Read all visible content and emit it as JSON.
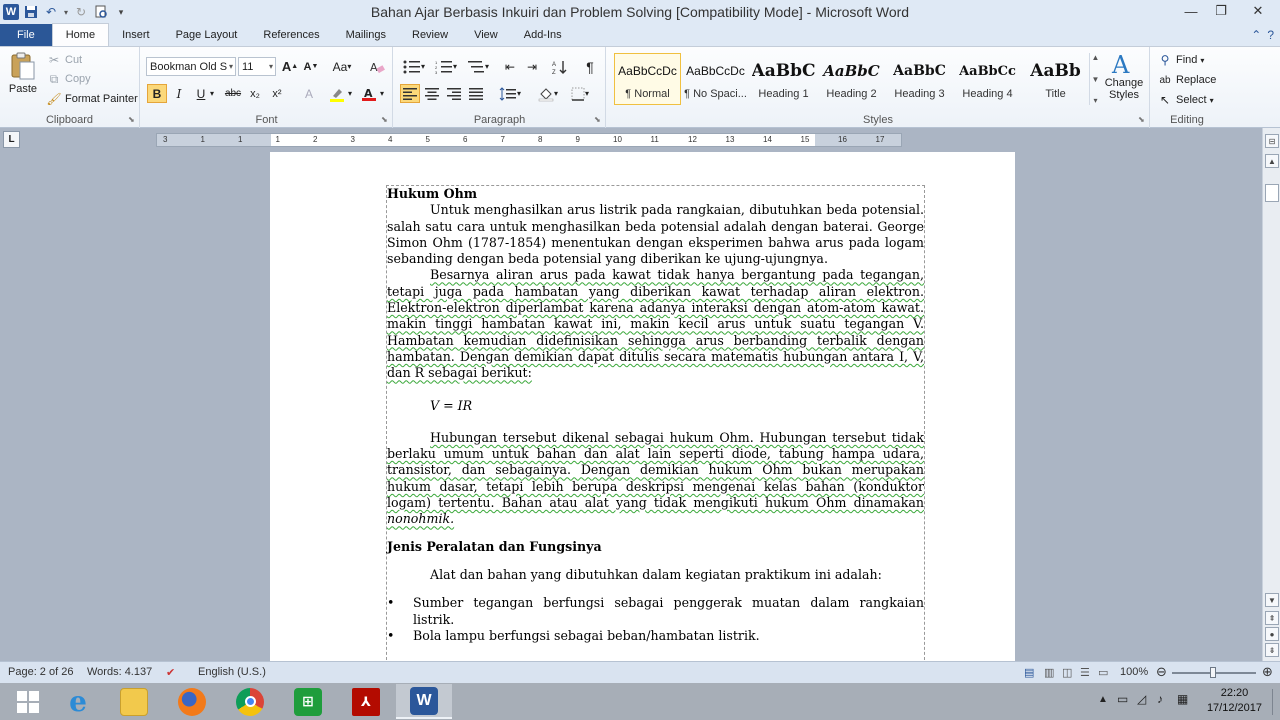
{
  "window": {
    "title": "Bahan Ajar Berbasis Inkuiri dan Problem Solving [Compatibility Mode]  -  Microsoft Word"
  },
  "tabs": [
    "File",
    "Home",
    "Insert",
    "Page Layout",
    "References",
    "Mailings",
    "Review",
    "View",
    "Add-Ins"
  ],
  "active_tab": "Home",
  "clipboard": {
    "paste": "Paste",
    "cut": "Cut",
    "copy": "Copy",
    "format_painter": "Format Painter",
    "label": "Clipboard"
  },
  "font": {
    "name": "Bookman Old S",
    "size": "11",
    "label": "Font",
    "bold": "B",
    "italic": "I",
    "underline": "U",
    "strike": "abc",
    "sub": "x₂",
    "sup": "x²",
    "case": "Aa"
  },
  "paragraph": {
    "label": "Paragraph",
    "pilcrow": "¶"
  },
  "styles": {
    "label": "Styles",
    "items": [
      {
        "sample": "AaBbCcDc",
        "name": "¶ Normal"
      },
      {
        "sample": "AaBbCcDc",
        "name": "¶ No Spaci..."
      },
      {
        "sample": "AaBbC",
        "name": "Heading 1"
      },
      {
        "sample": "AaBbC",
        "name": "Heading 2"
      },
      {
        "sample": "AaBbC",
        "name": "Heading 3"
      },
      {
        "sample": "AaBbCc",
        "name": "Heading 4"
      },
      {
        "sample": "AaBb",
        "name": "Title"
      }
    ],
    "change_styles_1": "Change",
    "change_styles_2": "Styles"
  },
  "editing": {
    "find": "Find",
    "replace": "Replace",
    "select": "Select",
    "label": "Editing"
  },
  "ruler": {
    "ticks": [
      "3",
      "1",
      "1",
      "1",
      "2",
      "3",
      "4",
      "5",
      "6",
      "7",
      "8",
      "9",
      "10",
      "11",
      "12",
      "13",
      "14",
      "15",
      "16",
      "17"
    ]
  },
  "document": {
    "heading1": "Hukum Ohm",
    "p1": "Untuk menghasilkan arus listrik pada rangkaian, dibutuhkan beda potensial. salah satu cara untuk menghasilkan beda potensial adalah dengan baterai. George Simon Ohm (1787-1854) menentukan dengan eksperimen bahwa arus pada logam sebanding dengan beda potensial yang diberikan ke ujung-ujungnya.",
    "p2": "Besarnya aliran arus pada kawat tidak hanya bergantung pada tegangan, tetapi juga pada hambatan yang diberikan kawat terhadap aliran elektron. Elektron-elektron diperlambat karena adanya interaksi dengan atom-atom kawat. makin tinggi hambatan kawat ini, makin kecil arus untuk suatu tegangan V. Hambatan kemudian didefinisikan sehingga arus berbanding terbalik dengan hambatan. Dengan demikian dapat ditulis secara matematis hubungan antara I, V, dan R sebagai berikut:",
    "equation": "V = IR",
    "p3_a": "Hubungan tersebut dikenal sebagai hukum Ohm. Hubungan tersebut tidak berlaku umum untuk bahan dan alat lain seperti diode, tabung hampa udara, transistor, dan sebagainya. Dengan demikian hukum Ohm bukan merupakan hukum dasar, tetapi lebih berupa deskripsi mengenai kelas bahan (konduktor logam) tertentu. Bahan atau alat yang tidak mengikuti hukum Ohm dinamakan",
    "p3_b": "nonohmik.",
    "heading2": "Jenis Peralatan dan Fungsinya",
    "p4": "Alat dan bahan yang dibutuhkan dalam kegiatan praktikum ini adalah:",
    "bullets": [
      "Sumber tegangan berfungsi sebagai penggerak muatan dalam rangkaian listrik.",
      "Bola lampu berfungsi sebagai beban/hambatan listrik."
    ]
  },
  "status": {
    "page": "Page: 2 of 26",
    "words": "Words: 4.137",
    "language": "English (U.S.)",
    "zoom": "100%",
    "zoom_level": 1.0
  },
  "taskbar": {
    "time": "22:20",
    "date": "17/12/2017"
  }
}
